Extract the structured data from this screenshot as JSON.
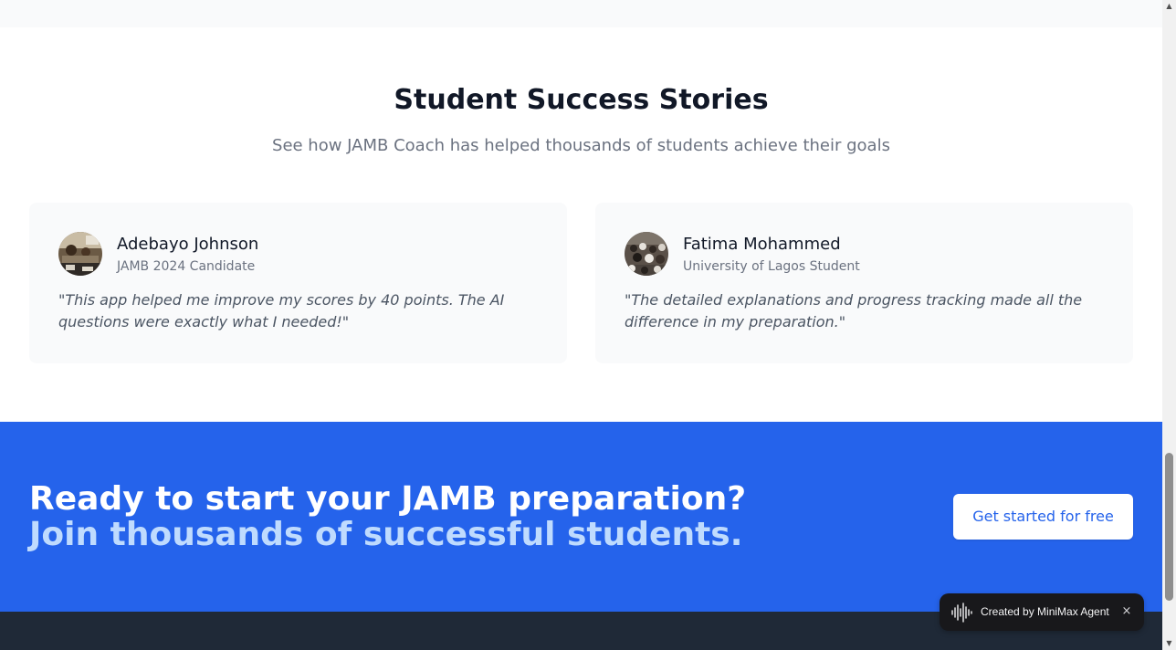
{
  "section": {
    "title": "Student Success Stories",
    "subtitle": "See how JAMB Coach has helped thousands of students achieve their goals"
  },
  "testimonials": [
    {
      "name": "Adebayo Johnson",
      "role": "JAMB 2024 Candidate",
      "quote": "\"This app helped me improve my scores by 40 points. The AI questions were exactly what I needed!\""
    },
    {
      "name": "Fatima Mohammed",
      "role": "University of Lagos Student",
      "quote": "\"The detailed explanations and progress tracking made all the difference in my preparation.\""
    }
  ],
  "cta": {
    "heading_line1": "Ready to start your JAMB preparation?",
    "heading_line2": "Join thousands of successful students.",
    "button_label": "Get started for free"
  },
  "badge": {
    "label": "Created by MiniMax Agent",
    "close_symbol": "×",
    "icon": "waveform-icon"
  },
  "colors": {
    "primary": "#2563eb",
    "primary_light": "#bfdbfe",
    "footer": "#1f2937",
    "heading": "#111827",
    "muted": "#6b7280"
  },
  "scrollbar": {
    "position_fraction": 0.87
  }
}
